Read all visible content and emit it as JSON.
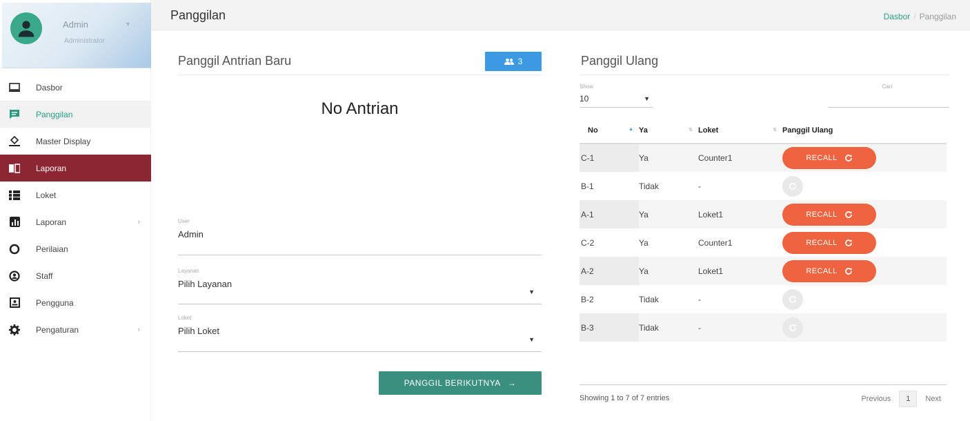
{
  "profile": {
    "name": "Admin",
    "role": "Administrator"
  },
  "sidebar": {
    "items": [
      {
        "label": "Dasbor",
        "icon": "monitor-icon"
      },
      {
        "label": "Panggilan",
        "icon": "chat-icon"
      },
      {
        "label": "Master Display",
        "icon": "paint-bucket-icon"
      },
      {
        "label": "Laporan",
        "icon": "report-icon"
      },
      {
        "label": "Loket",
        "icon": "grid-list-icon"
      },
      {
        "label": "Laporan",
        "icon": "bar-chart-icon"
      },
      {
        "label": "Perilaian",
        "icon": "circle-icon"
      },
      {
        "label": "Staff",
        "icon": "user-circle-icon"
      },
      {
        "label": "Pengguna",
        "icon": "account-box-icon"
      },
      {
        "label": "Pengaturan",
        "icon": "gear-icon"
      }
    ]
  },
  "header": {
    "title": "Panggilan",
    "breadcrumb": {
      "home": "Dasbor",
      "separator": "/",
      "current": "Panggilan"
    }
  },
  "call_panel": {
    "title": "Panggil Antrian Baru",
    "queue_count": "3",
    "no_antrian": "No Antrian",
    "user_label": "User",
    "user_value": "Admin",
    "layanan_label": "Layanan",
    "layanan_value": "Pilih Layanan",
    "loket_label": "Loket",
    "loket_value": "Pilih Loket",
    "next_button": "PANGGIL BERIKUTNYA"
  },
  "recall_panel": {
    "title": "Panggil Ulang",
    "show_label": "Show",
    "show_value": "10",
    "search_label": "Cari",
    "columns": [
      "No",
      "Ya",
      "Loket",
      "Panggil Ulang"
    ],
    "recall_label": "RECALL",
    "rows": [
      {
        "no": "C-1",
        "ya": "Ya",
        "loket": "Counter1",
        "recall": true
      },
      {
        "no": "B-1",
        "ya": "Tidak",
        "loket": "-",
        "recall": false
      },
      {
        "no": "A-1",
        "ya": "Ya",
        "loket": "Loket1",
        "recall": true
      },
      {
        "no": "C-2",
        "ya": "Ya",
        "loket": "Counter1",
        "recall": true
      },
      {
        "no": "A-2",
        "ya": "Ya",
        "loket": "Loket1",
        "recall": true
      },
      {
        "no": "B-2",
        "ya": "Tidak",
        "loket": "-",
        "recall": false
      },
      {
        "no": "B-3",
        "ya": "Tidak",
        "loket": "-",
        "recall": false
      }
    ],
    "info": "Showing 1 to 7 of 7 entries",
    "pager": {
      "previous": "Previous",
      "page": "1",
      "next": "Next"
    }
  },
  "colors": {
    "accent": "#3a8f7f",
    "active_menu": "#8b2632",
    "recall": "#ee6340",
    "badge": "#3b9ae1"
  }
}
